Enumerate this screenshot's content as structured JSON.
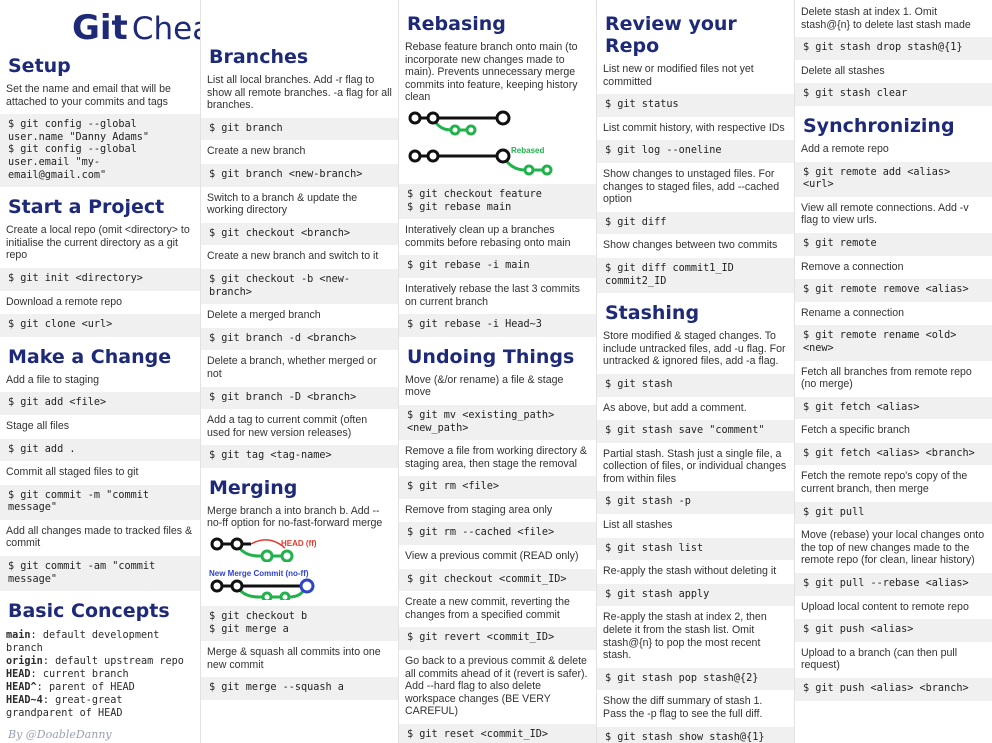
{
  "title": {
    "git": "Git",
    "rest": "Cheat Sheet"
  },
  "byline": "By @DoableDanny",
  "col1": {
    "setup": {
      "heading": "Setup",
      "desc": "Set the name and email that will be attached to your commits and tags",
      "cmd": "$ git config --global\nuser.name \"Danny Adams\"\n$ git config --global\nuser.email \"my-\nemail@gmail.com\""
    },
    "start": {
      "heading": "Start a Project",
      "d1": "Create a local repo (omit <directory> to initialise the current directory as a git repo",
      "c1": "$ git init <directory>",
      "d2": "Download a remote repo",
      "c2": "$ git clone <url>"
    },
    "change": {
      "heading": "Make a Change",
      "d1": "Add a file to staging",
      "c1": "$ git add <file>",
      "d2": "Stage all files",
      "c2": "$ git add .",
      "d3": "Commit all staged files to git",
      "c3": "$ git commit -m \"commit\nmessage\"",
      "d4": "Add all changes made to tracked files & commit",
      "c4": "$ git commit -am \"commit\nmessage\""
    },
    "concepts": {
      "heading": "Basic Concepts",
      "k1": "main",
      "v1": ": default development branch",
      "k2": "origin",
      "v2": ": default upstream repo",
      "k3": "HEAD",
      "v3": ": current branch",
      "k4": "HEAD^",
      "v4": ": parent of HEAD",
      "k5": "HEAD~4",
      "v5": ": great-great grandparent of HEAD"
    }
  },
  "col2": {
    "branches": {
      "heading": "Branches",
      "d1": "List all local branches. Add -r flag to show all remote branches. -a flag for all branches.",
      "c1": "$ git branch",
      "d2": "Create a new branch",
      "c2": "$ git branch <new-branch>",
      "d3": "Switch to a branch & update the working directory",
      "c3": "$ git checkout <branch>",
      "d4": "Create a new branch and switch to it",
      "c4": "$ git checkout -b <new-\nbranch>",
      "d5": "Delete a merged branch",
      "c5": "$ git branch -d <branch>",
      "d6": "Delete a branch, whether merged or not",
      "c6": "$ git branch -D <branch>",
      "d7": "Add a tag to current commit (often used for new version releases)",
      "c7": "$ git tag <tag-name>"
    },
    "merging": {
      "heading": "Merging",
      "d1": "Merge branch a into branch b. Add --no-ff option for no-fast-forward merge",
      "label_ff": "HEAD (ff)",
      "label_noff": "New Merge Commit (no-ff)",
      "c1": "$ git checkout b\n$ git merge a",
      "d2": "Merge & squash all commits into one new commit",
      "c2": "$ git merge --squash a"
    }
  },
  "col3": {
    "rebasing": {
      "heading": "Rebasing",
      "d1": "Rebase feature branch onto main (to incorporate new changes made to main). Prevents unnecessary merge commits into feature, keeping history clean",
      "label_rebased": "Rebased",
      "c1": "$ git checkout feature\n$ git rebase main",
      "d2": "Interatively clean up a branches commits before rebasing onto main",
      "c2": "$ git rebase -i main",
      "d3": "Interatively rebase the last 3 commits on current branch",
      "c3": "$ git rebase -i Head~3"
    },
    "undo": {
      "heading": "Undoing Things",
      "d1": "Move (&/or rename) a file & stage move",
      "c1": "$ git mv <existing_path>\n<new_path>",
      "d2": "Remove a file from working directory & staging area, then stage the removal",
      "c2": "$ git rm <file>",
      "d3": "Remove from staging area only",
      "c3": "$ git rm --cached <file>",
      "d4": "View a previous commit (READ only)",
      "c4": "$ git checkout <commit_ID>",
      "d5": "Create a new commit, reverting the changes from a specified commit",
      "c5": "$ git revert <commit_ID>",
      "d6": "Go back to a previous commit & delete all commits ahead of it (revert is safer). Add --hard flag to also delete workspace changes (BE VERY CAREFUL)",
      "c6": "$ git reset <commit_ID>"
    }
  },
  "col4": {
    "review": {
      "heading": "Review your Repo",
      "d1": "List new or modified files not yet committed",
      "c1": "$ git status",
      "d2": "List commit history, with respective IDs",
      "c2": "$ git log --oneline",
      "d3": "Show changes to unstaged files. For changes to staged files, add --cached option",
      "c3": "$ git diff",
      "d4": "Show changes between two commits",
      "c4": "$ git diff commit1_ID\ncommit2_ID"
    },
    "stashing": {
      "heading": "Stashing",
      "d1": "Store modified & staged changes. To include untracked files, add -u flag. For untracked & ignored files, add -a flag.",
      "c1": "$ git stash",
      "d2": "As above, but add a comment.",
      "c2": "$ git stash save \"comment\"",
      "d3": "Partial stash. Stash just a single file, a collection of files, or individual changes from within files",
      "c3": "$ git stash -p",
      "d4": "List all stashes",
      "c4": "$ git stash list",
      "d5": "Re-apply the stash without deleting it",
      "c5": "$ git stash apply",
      "d6": "Re-apply the stash at index 2, then delete it from the stash list. Omit stash@{n} to pop the most recent stash.",
      "c6": "$ git stash pop stash@{2}",
      "d7": "Show the diff summary of stash 1. Pass the -p flag to see the full diff.",
      "c7": "$ git stash show stash@{1}"
    }
  },
  "col5": {
    "stashcont": {
      "d1": "Delete stash at index 1. Omit stash@{n} to delete last stash made",
      "c1": "$ git stash drop stash@{1}",
      "d2": "Delete all stashes",
      "c2": "$ git stash clear"
    },
    "sync": {
      "heading": "Synchronizing",
      "d1": "Add a remote repo",
      "c1": "$ git remote add <alias>\n<url>",
      "d2": "View all remote connections. Add -v flag to view urls.",
      "c2": "$ git remote",
      "d3": "Remove a connection",
      "c3": "$ git remote remove <alias>",
      "d4": "Rename a connection",
      "c4": "$ git remote rename <old>\n<new>",
      "d5": "Fetch all branches from remote repo (no merge)",
      "c5": "$ git fetch <alias>",
      "d6": "Fetch a specific branch",
      "c6": "$ git fetch <alias> <branch>",
      "d7": "Fetch the remote repo's copy of the current branch, then merge",
      "c7": "$ git pull",
      "d8": "Move (rebase) your local changes onto the top of new changes made to the remote repo (for clean, linear history)",
      "c8": "$ git pull --rebase <alias>",
      "d9": "Upload local content to remote repo",
      "c9": "$ git push <alias>",
      "d10": "Upload to a branch (can then pull request)",
      "c10": "$ git push <alias> <branch>"
    }
  },
  "colors": {
    "heading": "#1e2a78",
    "commit_green": "#22b24c",
    "commit_black": "#111111",
    "head_red": "#e03a2f",
    "merge_blue": "#2f44c8",
    "cmd_bg": "#f0f0f0"
  }
}
